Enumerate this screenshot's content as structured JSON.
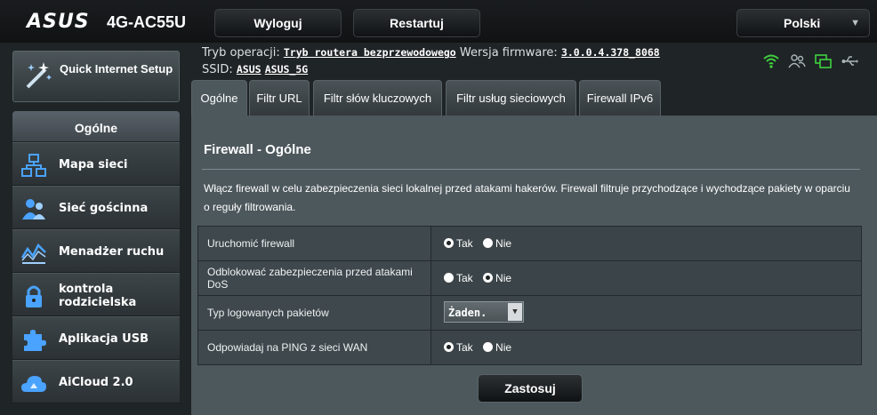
{
  "brand": {
    "logo": "ASUS",
    "model": "4G-AC55U"
  },
  "topbar": {
    "logout_label": "Wyloguj",
    "restart_label": "Restartuj",
    "language": "Polski"
  },
  "info": {
    "mode_label": "Tryb operacji:",
    "mode_value": "Tryb routera bezprzewodowego",
    "firmware_label": "Wersja firmware:",
    "firmware_value": "3.0.0.4.378_8068",
    "ssid_label": "SSID:",
    "ssid_1": "ASUS",
    "ssid_2": "ASUS_5G"
  },
  "status_icons": [
    "wifi-icon",
    "users-icon",
    "network-icon",
    "usb-icon"
  ],
  "sidebar": {
    "quick_setup": "Quick Internet Setup",
    "section_title": "Ogólne",
    "items": [
      {
        "label": "Mapa sieci",
        "icon": "network-map-icon"
      },
      {
        "label": "Sieć gościnna",
        "icon": "guest-network-icon"
      },
      {
        "label": "Menadżer ruchu",
        "icon": "traffic-manager-icon"
      },
      {
        "label": "kontrola rodzicielska",
        "icon": "lock-icon"
      },
      {
        "label": "Aplikacja USB",
        "icon": "puzzle-icon"
      },
      {
        "label": "AiCloud 2.0",
        "icon": "cloud-icon"
      }
    ]
  },
  "tabs": [
    {
      "label": "Ogólne",
      "active": true
    },
    {
      "label": "Filtr URL",
      "active": false
    },
    {
      "label": "Filtr słów kluczowych",
      "active": false
    },
    {
      "label": "Filtr usług sieciowych",
      "active": false
    },
    {
      "label": "Firewall IPv6",
      "active": false
    }
  ],
  "panel": {
    "title": "Firewall - Ogólne",
    "description": "Włącz firewall w celu zabezpieczenia sieci lokalnej przed atakami hakerów. Firewall filtruje przychodzące i wychodzące pakiety w oparciu o reguły filtrowania.",
    "rows": [
      {
        "label": "Uruchomić firewall",
        "yes": "Tak",
        "no": "Nie",
        "selected": "Tak"
      },
      {
        "label": "Odblokować zabezpieczenia przed atakami DoS",
        "yes": "Tak",
        "no": "Nie",
        "selected": "Nie"
      },
      {
        "label": "Typ logowanych pakietów",
        "select_value": "Żaden."
      },
      {
        "label": "Odpowiadaj na PING z sieci WAN",
        "yes": "Tak",
        "no": "Nie",
        "selected": "Tak"
      }
    ],
    "apply_label": "Zastosuj"
  },
  "colors": {
    "accent_green": "#3fd13f",
    "panel_bg": "#4d585d"
  }
}
